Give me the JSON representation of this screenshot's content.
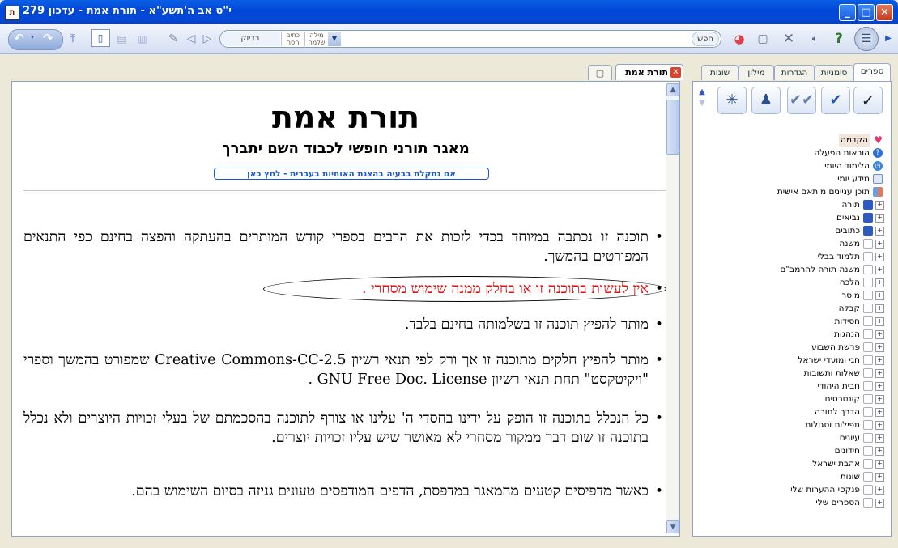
{
  "window": {
    "title": "י\"ט אב ה'תשע\"א  -  תורת אמת  -  עדכון 279",
    "app_icon": "book-icon",
    "minimize": "_",
    "maximize": "□",
    "close": "✕"
  },
  "toolbar": {
    "search_placeholder": "",
    "search_label": "חפש",
    "modes": [
      "מילה שלמה",
      "כתיב חסר",
      "בדיוק"
    ]
  },
  "tabs": {
    "main_tab": "תורת אמת",
    "close": "✕"
  },
  "document": {
    "title": "תורת אמת",
    "subtitle": "מאגר תורני חופשי לכבוד השם יתברך",
    "encoding_link": "אם נתקלת בבעיה בהצגת האותיות בעברית - לחץ כאן",
    "bullets": [
      "תוכנה זו נכתבה במיוחד בכדי לזכות את הרבים בספרי קודש המותרים בהעתקה והפצה בחינם כפי התנאים המפורטים בהמשך.",
      "אין לעשות בתוכנה זו או בחלק ממנה שימוש מסחרי .",
      "מותר להפיץ תוכנה זו בשלמותה בחינם בלבד.",
      "מותר להפיץ חלקים מתוכנה זו אך ורק לפי תנאי רשיון Creative Commons-CC-2.5 שמפורט בהמשך וספרי \"ויקיטקסט\" תחת תנאי רשיון GNU Free Doc. License .",
      "כל הנכלל בתוכנה זו הופק על ידינו בחסדי ה' עלינו או צורף לתוכנה בהסכמתם של בעלי זכויות היוצרים ולא נכלל בתוכנה זו שום דבר ממקור מסחרי לא מאושר שיש עליו זכויות יוצרים.",
      "כאשר מדפיסים קטעים מהמאגר במדפסת, הדפים המודפסים טעונים גניזה בסיום השימוש בהם."
    ]
  },
  "sidebar": {
    "tabs": [
      "ספרים",
      "סימניות",
      "הגדרות",
      "מילון",
      "שונות"
    ],
    "tree": [
      {
        "label": "הקדמה",
        "icon": "heart-icon",
        "color": "#E8356B"
      },
      {
        "label": "הוראות הפעלה",
        "icon": "help-icon",
        "color": "#2F6FD6"
      },
      {
        "label": "הלימוד היומי",
        "icon": "clock-icon",
        "color": "#3B86D8"
      },
      {
        "label": "מידע יומי",
        "icon": "calendar-icon",
        "color": "#8DA9D8"
      },
      {
        "label": "תוכן עניינים מותאם אישית",
        "icon": "grid-icon",
        "color": "#6BA0E0"
      },
      {
        "label": "תורה",
        "icon": "books-icon",
        "color": "#2B5BC0"
      },
      {
        "label": "נביאים",
        "icon": "books-icon",
        "color": "#2B5BC0"
      },
      {
        "label": "כתובים",
        "icon": "books-icon",
        "color": "#2B5BC0"
      },
      {
        "label": "משנה",
        "icon": "folder-icon"
      },
      {
        "label": "תלמוד בבלי",
        "icon": "folder-icon"
      },
      {
        "label": "משנה תורה להרמב\"ם",
        "icon": "folder-icon"
      },
      {
        "label": "הלכה",
        "icon": "folder-icon"
      },
      {
        "label": "מוסר",
        "icon": "folder-icon"
      },
      {
        "label": "קבלה",
        "icon": "folder-icon"
      },
      {
        "label": "חסידות",
        "icon": "folder-icon"
      },
      {
        "label": "הנהגות",
        "icon": "folder-icon"
      },
      {
        "label": "פרשת השבוע",
        "icon": "folder-icon"
      },
      {
        "label": "חגי ומועדי ישראל",
        "icon": "folder-icon"
      },
      {
        "label": "שאלות ותשובות",
        "icon": "folder-icon"
      },
      {
        "label": "חבית היהודי",
        "icon": "folder-icon"
      },
      {
        "label": "קונטרסים",
        "icon": "folder-icon"
      },
      {
        "label": "הדרך לתורה",
        "icon": "folder-icon"
      },
      {
        "label": "תפילות וסגולות",
        "icon": "folder-icon"
      },
      {
        "label": "עיונים",
        "icon": "folder-icon"
      },
      {
        "label": "חידונים",
        "icon": "folder-icon"
      },
      {
        "label": "אהבת ישראל",
        "icon": "folder-icon"
      },
      {
        "label": "שונות",
        "icon": "folder-icon"
      },
      {
        "label": "פנקסי ההערות שלי",
        "icon": "folder-icon"
      },
      {
        "label": "הספרים שלי",
        "icon": "folder-icon"
      }
    ]
  }
}
